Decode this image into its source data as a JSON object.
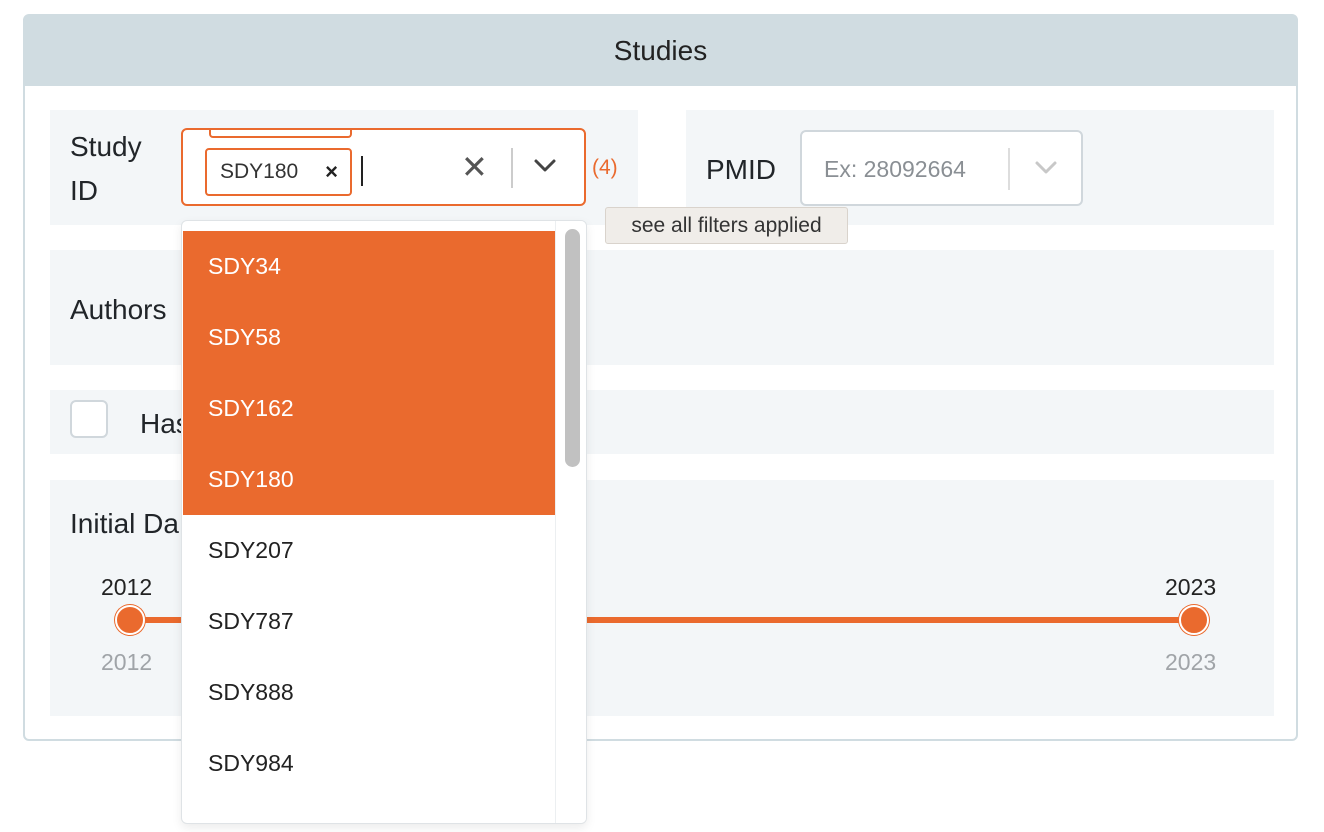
{
  "panel": {
    "title": "Studies"
  },
  "filters": {
    "study_id": {
      "label_line1": "Study",
      "label_line2": "ID",
      "chips": [
        "SDY180"
      ],
      "chip_remove": "×",
      "clear": "✕",
      "count_badge": "(4)",
      "options": [
        {
          "label": "SDY34",
          "selected": true
        },
        {
          "label": "SDY58",
          "selected": true
        },
        {
          "label": "SDY162",
          "selected": true
        },
        {
          "label": "SDY180",
          "selected": true
        },
        {
          "label": "SDY207",
          "selected": false
        },
        {
          "label": "SDY787",
          "selected": false
        },
        {
          "label": "SDY888",
          "selected": false
        },
        {
          "label": "SDY984",
          "selected": false
        }
      ]
    },
    "pmid": {
      "label": "PMID",
      "placeholder": "Ex: 28092664"
    },
    "tooltip": "see all filters applied",
    "authors": {
      "label": "Authors"
    },
    "has": {
      "label_visible": "Has"
    },
    "initial_date": {
      "label_visible": "Initial Da",
      "min_top": "2012",
      "max_top": "2023",
      "min_bottom": "2012",
      "max_bottom": "2023"
    }
  },
  "colors": {
    "accent": "#ea6a2e",
    "header_bg": "#d0dce1",
    "row_bg": "#f3f6f8"
  },
  "icons": {
    "chip_remove": "close-icon",
    "clear": "clear-icon",
    "dropdown": "chevron-down-icon"
  }
}
